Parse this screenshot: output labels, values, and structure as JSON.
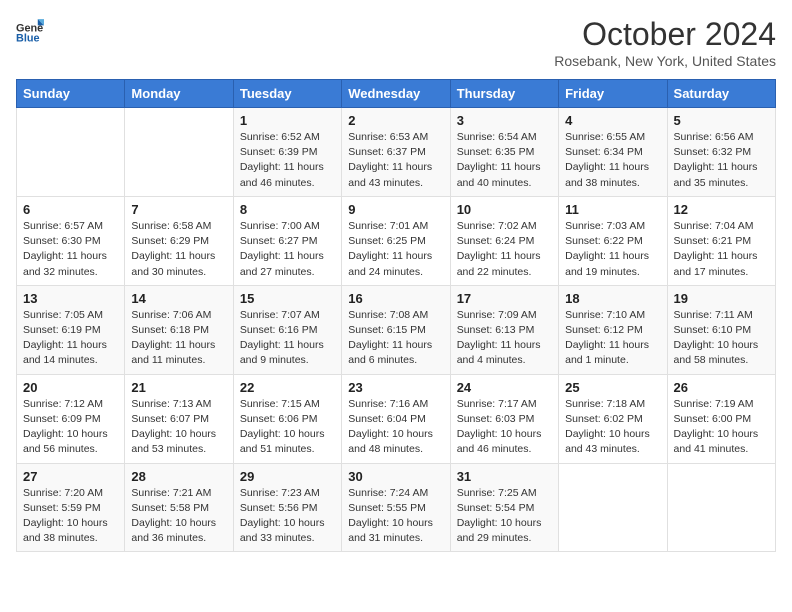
{
  "logo": {
    "line1": "General",
    "line2": "Blue"
  },
  "title": "October 2024",
  "location": "Rosebank, New York, United States",
  "days_of_week": [
    "Sunday",
    "Monday",
    "Tuesday",
    "Wednesday",
    "Thursday",
    "Friday",
    "Saturday"
  ],
  "weeks": [
    [
      {
        "day": "",
        "sunrise": "",
        "sunset": "",
        "daylight": ""
      },
      {
        "day": "",
        "sunrise": "",
        "sunset": "",
        "daylight": ""
      },
      {
        "day": "1",
        "sunrise": "Sunrise: 6:52 AM",
        "sunset": "Sunset: 6:39 PM",
        "daylight": "Daylight: 11 hours and 46 minutes."
      },
      {
        "day": "2",
        "sunrise": "Sunrise: 6:53 AM",
        "sunset": "Sunset: 6:37 PM",
        "daylight": "Daylight: 11 hours and 43 minutes."
      },
      {
        "day": "3",
        "sunrise": "Sunrise: 6:54 AM",
        "sunset": "Sunset: 6:35 PM",
        "daylight": "Daylight: 11 hours and 40 minutes."
      },
      {
        "day": "4",
        "sunrise": "Sunrise: 6:55 AM",
        "sunset": "Sunset: 6:34 PM",
        "daylight": "Daylight: 11 hours and 38 minutes."
      },
      {
        "day": "5",
        "sunrise": "Sunrise: 6:56 AM",
        "sunset": "Sunset: 6:32 PM",
        "daylight": "Daylight: 11 hours and 35 minutes."
      }
    ],
    [
      {
        "day": "6",
        "sunrise": "Sunrise: 6:57 AM",
        "sunset": "Sunset: 6:30 PM",
        "daylight": "Daylight: 11 hours and 32 minutes."
      },
      {
        "day": "7",
        "sunrise": "Sunrise: 6:58 AM",
        "sunset": "Sunset: 6:29 PM",
        "daylight": "Daylight: 11 hours and 30 minutes."
      },
      {
        "day": "8",
        "sunrise": "Sunrise: 7:00 AM",
        "sunset": "Sunset: 6:27 PM",
        "daylight": "Daylight: 11 hours and 27 minutes."
      },
      {
        "day": "9",
        "sunrise": "Sunrise: 7:01 AM",
        "sunset": "Sunset: 6:25 PM",
        "daylight": "Daylight: 11 hours and 24 minutes."
      },
      {
        "day": "10",
        "sunrise": "Sunrise: 7:02 AM",
        "sunset": "Sunset: 6:24 PM",
        "daylight": "Daylight: 11 hours and 22 minutes."
      },
      {
        "day": "11",
        "sunrise": "Sunrise: 7:03 AM",
        "sunset": "Sunset: 6:22 PM",
        "daylight": "Daylight: 11 hours and 19 minutes."
      },
      {
        "day": "12",
        "sunrise": "Sunrise: 7:04 AM",
        "sunset": "Sunset: 6:21 PM",
        "daylight": "Daylight: 11 hours and 17 minutes."
      }
    ],
    [
      {
        "day": "13",
        "sunrise": "Sunrise: 7:05 AM",
        "sunset": "Sunset: 6:19 PM",
        "daylight": "Daylight: 11 hours and 14 minutes."
      },
      {
        "day": "14",
        "sunrise": "Sunrise: 7:06 AM",
        "sunset": "Sunset: 6:18 PM",
        "daylight": "Daylight: 11 hours and 11 minutes."
      },
      {
        "day": "15",
        "sunrise": "Sunrise: 7:07 AM",
        "sunset": "Sunset: 6:16 PM",
        "daylight": "Daylight: 11 hours and 9 minutes."
      },
      {
        "day": "16",
        "sunrise": "Sunrise: 7:08 AM",
        "sunset": "Sunset: 6:15 PM",
        "daylight": "Daylight: 11 hours and 6 minutes."
      },
      {
        "day": "17",
        "sunrise": "Sunrise: 7:09 AM",
        "sunset": "Sunset: 6:13 PM",
        "daylight": "Daylight: 11 hours and 4 minutes."
      },
      {
        "day": "18",
        "sunrise": "Sunrise: 7:10 AM",
        "sunset": "Sunset: 6:12 PM",
        "daylight": "Daylight: 11 hours and 1 minute."
      },
      {
        "day": "19",
        "sunrise": "Sunrise: 7:11 AM",
        "sunset": "Sunset: 6:10 PM",
        "daylight": "Daylight: 10 hours and 58 minutes."
      }
    ],
    [
      {
        "day": "20",
        "sunrise": "Sunrise: 7:12 AM",
        "sunset": "Sunset: 6:09 PM",
        "daylight": "Daylight: 10 hours and 56 minutes."
      },
      {
        "day": "21",
        "sunrise": "Sunrise: 7:13 AM",
        "sunset": "Sunset: 6:07 PM",
        "daylight": "Daylight: 10 hours and 53 minutes."
      },
      {
        "day": "22",
        "sunrise": "Sunrise: 7:15 AM",
        "sunset": "Sunset: 6:06 PM",
        "daylight": "Daylight: 10 hours and 51 minutes."
      },
      {
        "day": "23",
        "sunrise": "Sunrise: 7:16 AM",
        "sunset": "Sunset: 6:04 PM",
        "daylight": "Daylight: 10 hours and 48 minutes."
      },
      {
        "day": "24",
        "sunrise": "Sunrise: 7:17 AM",
        "sunset": "Sunset: 6:03 PM",
        "daylight": "Daylight: 10 hours and 46 minutes."
      },
      {
        "day": "25",
        "sunrise": "Sunrise: 7:18 AM",
        "sunset": "Sunset: 6:02 PM",
        "daylight": "Daylight: 10 hours and 43 minutes."
      },
      {
        "day": "26",
        "sunrise": "Sunrise: 7:19 AM",
        "sunset": "Sunset: 6:00 PM",
        "daylight": "Daylight: 10 hours and 41 minutes."
      }
    ],
    [
      {
        "day": "27",
        "sunrise": "Sunrise: 7:20 AM",
        "sunset": "Sunset: 5:59 PM",
        "daylight": "Daylight: 10 hours and 38 minutes."
      },
      {
        "day": "28",
        "sunrise": "Sunrise: 7:21 AM",
        "sunset": "Sunset: 5:58 PM",
        "daylight": "Daylight: 10 hours and 36 minutes."
      },
      {
        "day": "29",
        "sunrise": "Sunrise: 7:23 AM",
        "sunset": "Sunset: 5:56 PM",
        "daylight": "Daylight: 10 hours and 33 minutes."
      },
      {
        "day": "30",
        "sunrise": "Sunrise: 7:24 AM",
        "sunset": "Sunset: 5:55 PM",
        "daylight": "Daylight: 10 hours and 31 minutes."
      },
      {
        "day": "31",
        "sunrise": "Sunrise: 7:25 AM",
        "sunset": "Sunset: 5:54 PM",
        "daylight": "Daylight: 10 hours and 29 minutes."
      },
      {
        "day": "",
        "sunrise": "",
        "sunset": "",
        "daylight": ""
      },
      {
        "day": "",
        "sunrise": "",
        "sunset": "",
        "daylight": ""
      }
    ]
  ]
}
